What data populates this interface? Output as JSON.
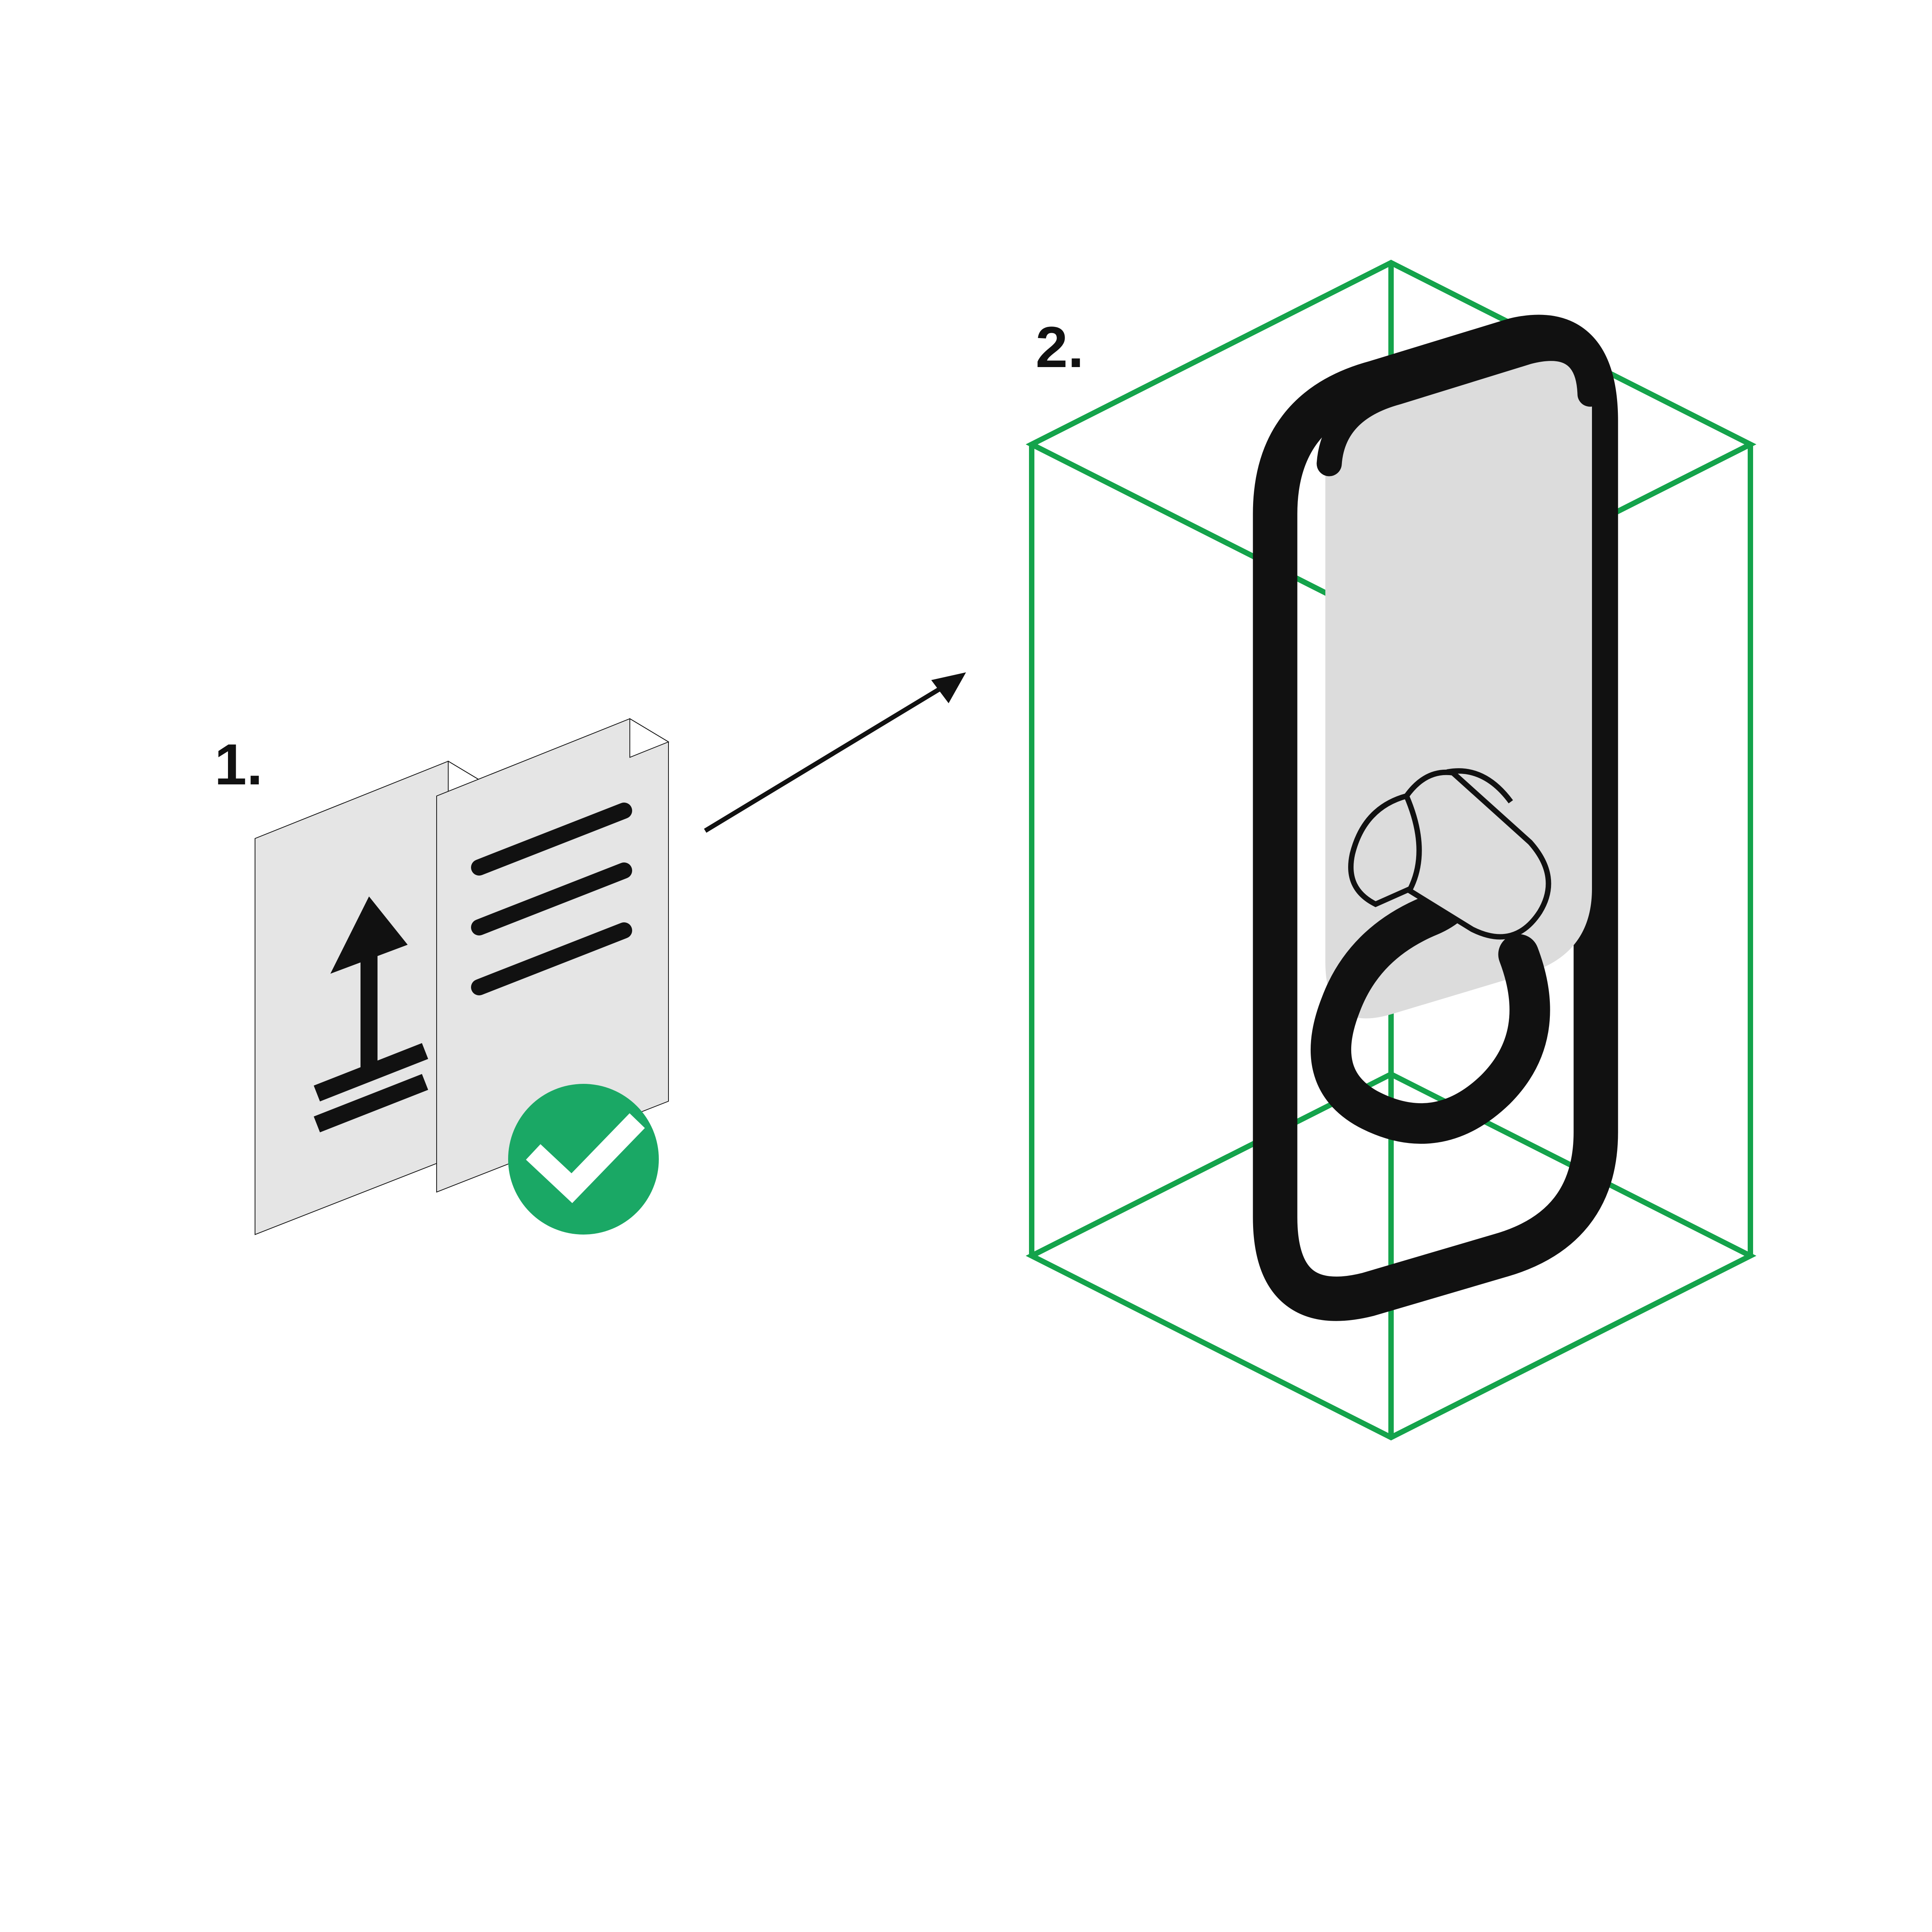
{
  "steps": {
    "one": {
      "label": "1."
    },
    "two": {
      "label": "2."
    }
  },
  "colors": {
    "paper_fill": "#e5e5e5",
    "paper_stroke": "#111111",
    "fold_fill": "#ffffff",
    "ink": "#111111",
    "check_bg": "#1aa865",
    "check_fg": "#ffffff",
    "cube_stroke": "#14a34b",
    "device_body": "#dcdcdc",
    "device_outline": "#111111",
    "arrow": "#111111"
  },
  "icons": {
    "first_page": "upload-icon",
    "second_page": "text-lines-icon",
    "badge": "checkmark-icon",
    "device": "ev-charger-icon",
    "frame": "cube-wireframe-icon",
    "connector": "arrow-icon"
  }
}
